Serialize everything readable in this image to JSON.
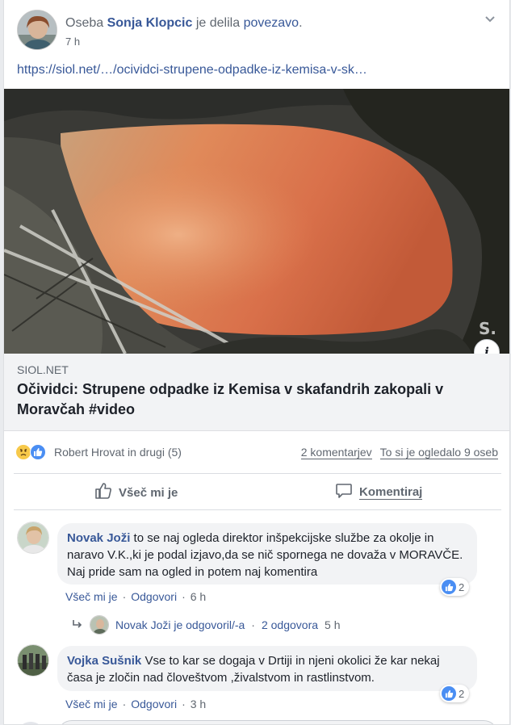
{
  "post": {
    "prefix": "Oseba",
    "author": "Sonja Klopcic",
    "action": "je delila",
    "link_word": "povezavo",
    "period": ".",
    "time": "7 h",
    "url": "https://siol.net/…/ocividci-strupene-odpadke-iz-kemisa-v-sk…"
  },
  "link_preview": {
    "domain": "SIOL.NET",
    "title": "Očividci: Strupene odpadke iz Kemisa v skafandrih zakopali v Moravčah #video",
    "watermark": "S.",
    "info_glyph": "i"
  },
  "reactions": {
    "icons": [
      "sad-reaction-icon",
      "like-reaction-icon"
    ],
    "summary": "Robert Hrovat in drugi (5)",
    "comments": "2 komentarjev",
    "views": "To si je ogledalo 9 oseb"
  },
  "actions": {
    "like": "Všeč mi je",
    "comment": "Komentiraj"
  },
  "comments": [
    {
      "name": "Novak Joži",
      "text": "to se naj ogleda direktor inšpekcijske službe za okolje in naravo V.K.,ki je podal izjavo,da se nič spornega ne dovaža v MORAVČE. Naj pride sam na ogled in potem naj komentira",
      "reaction_count": "2",
      "like_label": "Všeč mi je",
      "reply_label": "Odgovori",
      "separator": "·",
      "time": "6 h"
    },
    {
      "name": "Vojka Sušnik",
      "text": "Vse to kar se dogaja v Drtiji in njeni okolici že kar nekaj časa je zločin nad človeštvom ,živalstvom in rastlinstvom.",
      "reaction_count": "2",
      "like_label": "Všeč mi je",
      "reply_label": "Odgovori",
      "separator": "·",
      "time": "3 h"
    }
  ],
  "reply_thread": {
    "text": "Novak Joži je odgovoril/-a",
    "separator": "·",
    "count": "2 odgovora",
    "time": "5 h"
  },
  "colors": {
    "link_blue": "#385898",
    "muted_gray": "#606770",
    "like_blue": "#4a8ef3",
    "sad_yellow": "#f7c94a"
  }
}
